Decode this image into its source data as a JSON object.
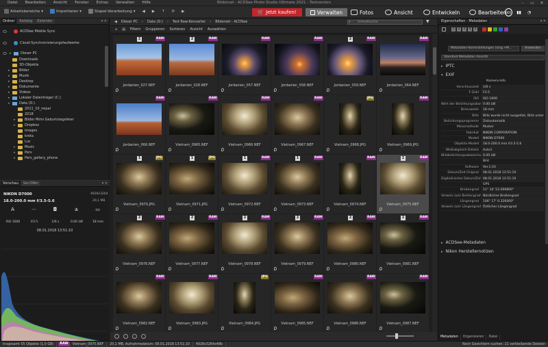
{
  "window": {
    "title": "Bildersat - ACDSee Photo Studio Ultimate 2021 - Testversion",
    "menu": [
      "Datei",
      "Bearbeiten",
      "Ansicht",
      "Fenster",
      "Extras",
      "Verwalten",
      "Hilfe"
    ]
  },
  "toolbar": {
    "workspaces": "Arbeitsbereiche",
    "import": "Importieren",
    "batch": "Stapel-Verarbeitung",
    "buy": "Jetzt kaufen!",
    "modes": [
      "Verwalten",
      "Fotos",
      "Ansicht",
      "Entwickeln",
      "Bearbeiten"
    ],
    "right_icons": [
      "365",
      "graph-icon",
      "dashboard-icon"
    ]
  },
  "left_panel": {
    "tabs": [
      "Ordner",
      "Katalog",
      "Kalender"
    ],
    "tree": [
      {
        "label": "ACDSee Mobile Sync",
        "icon": "red-circle"
      },
      {
        "label": "Cloud-Synchronisierungsfaufwerke",
        "icon": "blue-circle"
      },
      {
        "label": "Dieser PC",
        "icon": "drive"
      },
      {
        "label": "Downloads",
        "icon": "folder"
      },
      {
        "label": "3D-Objekte",
        "icon": "folder"
      },
      {
        "label": "Bilder",
        "icon": "folder"
      },
      {
        "label": "Musik",
        "icon": "folder"
      },
      {
        "label": "Desktop",
        "icon": "folder"
      },
      {
        "label": "Dokumente",
        "icon": "folder"
      },
      {
        "label": "Videos",
        "icon": "folder"
      },
      {
        "label": "Lokaler Datenträger (C:)",
        "icon": "drive"
      },
      {
        "label": "Data (D:)",
        "icon": "drive"
      },
      {
        "label": "2011_10_nepal",
        "icon": "folder"
      },
      {
        "label": "2018",
        "icon": "folder"
      },
      {
        "label": "Bilder Mimi Geburtstagsfeier",
        "icon": "folder"
      },
      {
        "label": "Dropbox",
        "icon": "folder"
      },
      {
        "label": "images",
        "icon": "folder"
      },
      {
        "label": "kreta",
        "icon": "folder"
      },
      {
        "label": "Luc",
        "icon": "folder"
      },
      {
        "label": "Music",
        "icon": "folder"
      },
      {
        "label": "Pers",
        "icon": "folder"
      },
      {
        "label": "Pers_gallery_phone",
        "icon": "folder"
      }
    ],
    "preview_tabs": [
      "Vorschau",
      "Sen3Wer"
    ],
    "camera": "NIKON D7000",
    "dimensions": "4928x3264",
    "lens": "18.0-200.0 mm f/3.5-5.6",
    "filesize": "20,1 MB",
    "icons": [
      "A",
      "⋯",
      "◘",
      "±",
      "▭"
    ],
    "values": [
      "ISO 1600",
      "f/3.5",
      "1/6 s",
      "0.00 LW",
      "18 mm"
    ],
    "date": "08.01.2018 13:51:10"
  },
  "center": {
    "path": [
      "Dieser PC",
      "Data (D:)",
      "Test Raw-Konverter",
      "Bilderset - ACDSee"
    ],
    "search_placeholder": "Schnellsuche",
    "filters": [
      "Filtern",
      "Gruppieren",
      "Sortieren",
      "Ansicht",
      "Auswählen"
    ],
    "thumbnails": [
      {
        "badge": "2",
        "fmt": "RAW",
        "name": "Jordanien_027.NEF",
        "scene": "desert-day"
      },
      {
        "badge": "2",
        "fmt": "RAW",
        "name": "Jordanien_028.NEF",
        "scene": "desert-day2"
      },
      {
        "badge": "",
        "fmt": "RAW",
        "name": "Jordanien_057.NEF",
        "scene": "sunset"
      },
      {
        "badge": "",
        "fmt": "RAW",
        "name": "Jordanien_058.NEF",
        "scene": "sunset2"
      },
      {
        "badge": "2",
        "fmt": "RAW",
        "name": "Jordanien_059.NEF",
        "scene": "sunset3"
      },
      {
        "badge": "",
        "fmt": "RAW",
        "name": "Jordanien_064.NEF",
        "scene": "dusk"
      },
      {
        "badge": "",
        "fmt": "RAW",
        "name": "Jordanien_066.NEF",
        "scene": "desert-day3"
      },
      {
        "badge": "",
        "fmt": "RAW",
        "name": "Vietnam_0965.NEF",
        "scene": "cave-dark"
      },
      {
        "badge": "",
        "fmt": "RAW",
        "name": "Vietnam_0966.NEF",
        "scene": "cave-light"
      },
      {
        "badge": "",
        "fmt": "RAW",
        "name": "Vietnam_0967.NEF",
        "scene": "cave"
      },
      {
        "badge": "",
        "fmt": "JPG",
        "name": "Vietnam_0968.JPG",
        "scene": "cave-port",
        "portrait": true
      },
      {
        "badge": "",
        "fmt": "RAW",
        "name": "Vietnam_0969.JPG",
        "scene": "cave-port",
        "portrait": true
      },
      {
        "badge": "1",
        "fmt": "JPG",
        "name": "Vietnam_0970.JPG",
        "scene": "cave"
      },
      {
        "badge": "1",
        "fmt": "JPG",
        "name": "Vietnam_0971.JPG",
        "scene": "cave2"
      },
      {
        "badge": "1",
        "fmt": "RAW",
        "name": "Vietnam_0972.NEF",
        "scene": "cave-light"
      },
      {
        "badge": "1",
        "fmt": "RAW",
        "name": "Vietnam_0973.NEF",
        "scene": "cave"
      },
      {
        "badge": "",
        "fmt": "RAW",
        "name": "Vietnam_0974.NEF",
        "scene": "cave-port",
        "portrait": true
      },
      {
        "badge": "1",
        "fmt": "RAW",
        "name": "Vietnam_0975.NEF",
        "scene": "cave-light",
        "selected": true
      },
      {
        "badge": "2",
        "fmt": "RAW",
        "name": "Vietnam_0976.NEF",
        "scene": "cave"
      },
      {
        "badge": "2",
        "fmt": "RAW",
        "name": "Vietnam_0977.NEF",
        "scene": "cave2"
      },
      {
        "badge": "2",
        "fmt": "RAW",
        "name": "Vietnam_0978.NEF",
        "scene": "cave-light"
      },
      {
        "badge": "2",
        "fmt": "RAW",
        "name": "Vietnam_0979.NEF",
        "scene": "cave"
      },
      {
        "badge": "2",
        "fmt": "RAW",
        "name": "Vietnam_0980.NEF",
        "scene": "cave2"
      },
      {
        "badge": "2",
        "fmt": "RAW",
        "name": "Vietnam_0981.NEF",
        "scene": "cave-dark"
      },
      {
        "badge": "",
        "fmt": "RAW",
        "name": "Vietnam_0982.NEF",
        "scene": "cave"
      },
      {
        "badge": "",
        "fmt": "RAW",
        "name": "Vietnam_0983.JPG",
        "scene": "cave-light"
      },
      {
        "badge": "",
        "fmt": "JPG",
        "name": "Vietnam_0984.JPG",
        "scene": "cave-port",
        "portrait": true
      },
      {
        "badge": "",
        "fmt": "RAW",
        "name": "Vietnam_0985.NEF",
        "scene": "cave2"
      },
      {
        "badge": "",
        "fmt": "RAW",
        "name": "Vietnam_0986.NEF",
        "scene": "cave"
      },
      {
        "badge": "",
        "fmt": "RAW",
        "name": "Vietnam_0987.NEF",
        "scene": "cave-dark"
      }
    ]
  },
  "status": {
    "total": "Insgesamt 55 Objekte (1,0 GB)",
    "format": "RAW",
    "file": "Vietnam_0975.NEF",
    "size": "20,1 MB, Aufnahmedatum: 08.01.2018 13:51:10",
    "dims": "4928x3264x48b"
  },
  "right_panel": {
    "tabs": [
      "Eigenschaften - Metadaten"
    ],
    "rating_boxes": [
      "1",
      "2",
      "3",
      "4",
      "5"
    ],
    "label_colors": [
      "#c03030",
      "#d8c020",
      "#30a030",
      "#3060c0",
      "#9040a0"
    ],
    "view_select": "Metadaten-Voreinstellungen (sing.+M...",
    "apply_button": "Anwenden",
    "meta_view": "Standard Metadaten Ansicht",
    "sections": [
      "IPTC",
      "EXIF",
      "ACDSee-Metadaten",
      "Nikon Herstellernotizen"
    ],
    "exif_group": "Kamera-Info",
    "exif": [
      [
        "Verschlusszeit",
        "1/6 s"
      ],
      [
        "F-Zahl",
        "F3.5"
      ],
      [
        "ISO",
        "ISO 1600"
      ],
      [
        "Wert der Belichtungsabweichu...",
        "0.00 LW"
      ],
      [
        "Brennweite",
        "18 mm"
      ],
      [
        "Blitz",
        "Blitz wurde nicht ausgelöst, Blitz unterdrücken Modus"
      ],
      [
        "Belichtungsprogramm",
        "Zeitautomatik"
      ],
      [
        "Messmethode",
        "Muster"
      ],
      [
        "Fabrikat",
        "NIKON CORPORATION"
      ],
      [
        "Modell",
        "NIKON D7000"
      ],
      [
        "Objektiv-Modell",
        "18.0-200.0 mm f/3.5-5.6"
      ],
      [
        "Weißabgleich-Details",
        "Auto1"
      ],
      [
        "Blitzbelichtungsabweichung",
        "0.00 LW"
      ],
      [
        "",
        "Bild"
      ],
      [
        "Software",
        "Ver.1.03"
      ],
      [
        "Datum/Zeit Original",
        "08.01.2018 13:51:10"
      ],
      [
        "Digitalisiertes Datum/Zeit",
        "08.01.2018 13:51:10"
      ],
      [
        "",
        "GPS"
      ],
      [
        "Breitengrad",
        "11° 34' 53.566800\""
      ],
      [
        "Verweis zum Breitengrad",
        "Nördlicher Breitengrad"
      ],
      [
        "Längengrad",
        "106° 17' 0.326400\""
      ],
      [
        "Verweis zum Längengrad",
        "Östlicher Längengrad"
      ]
    ],
    "bottom_tabs": [
      "Metadaten",
      "Organisieren",
      "Datei"
    ],
    "footer": "Noch Gesichtern suchen: 21 verbleibende Dateien"
  }
}
